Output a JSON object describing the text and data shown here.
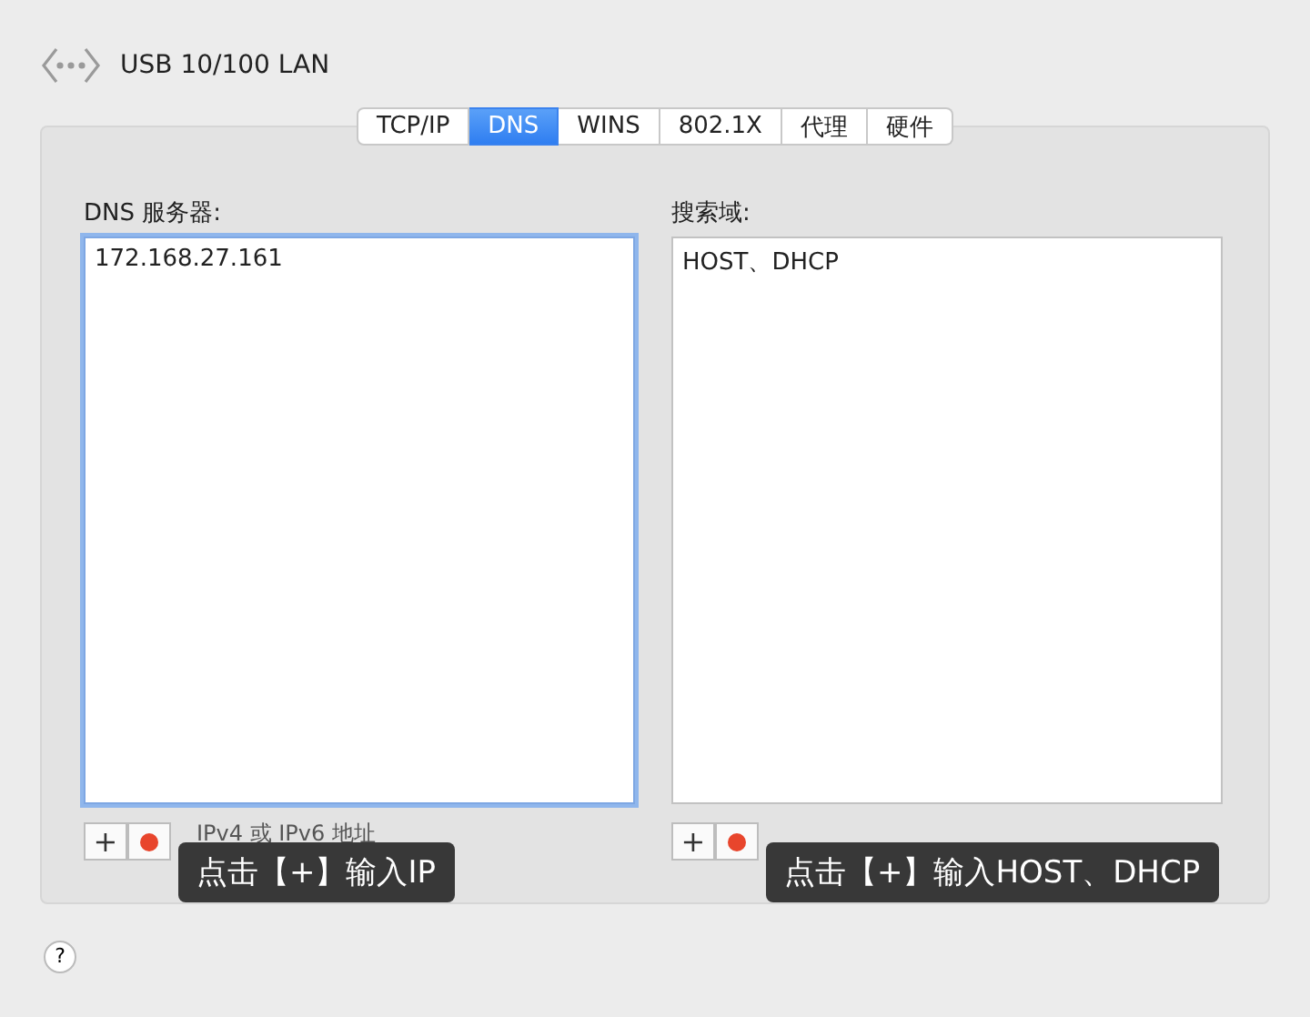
{
  "header": {
    "title": "USB 10/100 LAN"
  },
  "tabs": [
    {
      "label": "TCP/IP",
      "selected": false
    },
    {
      "label": "DNS",
      "selected": true
    },
    {
      "label": "WINS",
      "selected": false
    },
    {
      "label": "802.1X",
      "selected": false
    },
    {
      "label": "代理",
      "selected": false
    },
    {
      "label": "硬件",
      "selected": false
    }
  ],
  "lists": [
    {
      "label": "DNS 服务器:",
      "focused": true,
      "items": [
        "172.168.27.161"
      ],
      "add": "+",
      "hint": "IPv4 或 IPv6 地址",
      "tooltip": "点击【+】输入IP"
    },
    {
      "label": "搜索域:",
      "focused": false,
      "items": [
        "HOST、DHCP"
      ],
      "add": "+",
      "tooltip": "点击【+】输入HOST、DHCP"
    }
  ],
  "help": "?"
}
